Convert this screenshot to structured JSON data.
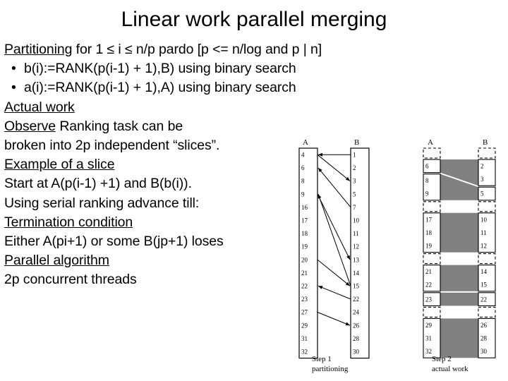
{
  "slide": {
    "title": "Linear work parallel merging"
  },
  "body": {
    "lines": [
      {
        "id": "partitioning",
        "underline": "Partitioning",
        "rest": " for 1 ≤ i ≤ n/p pardo [p <= n/log and p | n]",
        "bullet": false
      },
      {
        "id": "bullet-b",
        "underline": "",
        "rest": "b(i):=RANK(p(i-1) + 1),B) using binary search",
        "bullet": true
      },
      {
        "id": "bullet-a",
        "underline": "",
        "rest": "a(i):=RANK(p(i-1) + 1),A) using binary search",
        "bullet": true
      },
      {
        "id": "actual-work",
        "underline": "Actual work",
        "rest": "",
        "bullet": false
      },
      {
        "id": "observe",
        "underline": "Observe",
        "rest": " Ranking task can be",
        "bullet": false
      },
      {
        "id": "broken-into",
        "underline": "",
        "rest": "broken into 2p independent “slices”.",
        "bullet": false
      },
      {
        "id": "example-slice",
        "underline": "Example of a slice",
        "rest": "",
        "bullet": false
      },
      {
        "id": "start-at",
        "underline": "",
        "rest": "Start at A(p(i-1) +1) and B(b(i)).",
        "bullet": false
      },
      {
        "id": "using-serial",
        "underline": "",
        "rest": "Using serial ranking advance till:",
        "bullet": false
      },
      {
        "id": "termination",
        "underline": "Termination condition",
        "rest": "",
        "bullet": false
      },
      {
        "id": "either-a",
        "underline": "",
        "rest": "Either A(pi+1) or some B(jp+1) loses",
        "bullet": false
      },
      {
        "id": "parallel-algo",
        "underline": "Parallel algorithm",
        "rest": "",
        "bullet": false
      },
      {
        "id": "2p-threads",
        "underline": "",
        "rest": "2p concurrent threads",
        "bullet": false
      }
    ],
    "bullet_glyph": "•"
  },
  "figures": {
    "step1": {
      "caption_line1": "Step 1",
      "caption_line2": "partitioning",
      "column_a_label": "A",
      "column_b_label": "B",
      "column_a_values": [
        4,
        6,
        8,
        9,
        16,
        17,
        18,
        19,
        20,
        21,
        22,
        23,
        27,
        29,
        31,
        32
      ],
      "column_b_values": [
        1,
        2,
        3,
        5,
        7,
        10,
        11,
        12,
        13,
        14,
        15,
        22,
        24,
        26,
        28,
        30
      ],
      "arrows": [
        {
          "from": "B",
          "from_index": 0,
          "to": "A",
          "to_index": 0,
          "direction": "to-A"
        },
        {
          "from": "A",
          "from_index": 0,
          "to": "B",
          "to_index": 2,
          "direction": "to-B"
        },
        {
          "from": "B",
          "from_index": 4,
          "to": "A",
          "to_index": 1,
          "direction": "to-A"
        },
        {
          "from": "A",
          "from_index": 3,
          "to": "B",
          "to_index": 8,
          "direction": "to-B"
        },
        {
          "from": "B",
          "from_index": 10,
          "to": "A",
          "to_index": 3,
          "direction": "to-A"
        },
        {
          "from": "A",
          "from_index": 8,
          "to": "B",
          "to_index": 10,
          "direction": "to-B"
        },
        {
          "from": "B",
          "from_index": 11,
          "to": "A",
          "to_index": 10,
          "direction": "to-A"
        },
        {
          "from": "A",
          "from_index": 12,
          "to": "B",
          "to_index": 13,
          "direction": "to-B"
        }
      ]
    },
    "step2": {
      "caption_line1": "Step 2",
      "caption_line2": "actual work",
      "column_a_label": "A",
      "column_b_label": "B",
      "column_a_groups": [
        {
          "values": [],
          "dashed": true
        },
        {
          "values": [
            6
          ],
          "dashed": false
        },
        {
          "values": [
            8,
            9
          ],
          "dashed": false
        },
        {
          "values": [],
          "dashed": true
        },
        {
          "values": [
            17,
            18,
            19
          ],
          "dashed": false
        },
        {
          "values": [],
          "dashed": true
        },
        {
          "values": [
            21,
            22
          ],
          "dashed": false
        },
        {
          "values": [
            23
          ],
          "dashed": false
        },
        {
          "values": [],
          "dashed": true
        },
        {
          "values": [
            29,
            31,
            32
          ],
          "dashed": false
        }
      ],
      "column_b_groups": [
        {
          "values": [],
          "dashed": true
        },
        {
          "values": [
            2,
            3
          ],
          "dashed": false
        },
        {
          "values": [
            5
          ],
          "dashed": false
        },
        {
          "values": [],
          "dashed": true
        },
        {
          "values": [
            10,
            11,
            12
          ],
          "dashed": false
        },
        {
          "values": [],
          "dashed": true
        },
        {
          "values": [
            14,
            15
          ],
          "dashed": false
        },
        {
          "values": [
            22
          ],
          "dashed": false
        },
        {
          "values": [],
          "dashed": true
        },
        {
          "values": [
            26,
            28,
            30
          ],
          "dashed": false
        }
      ],
      "slice_fill": "#808080"
    }
  }
}
